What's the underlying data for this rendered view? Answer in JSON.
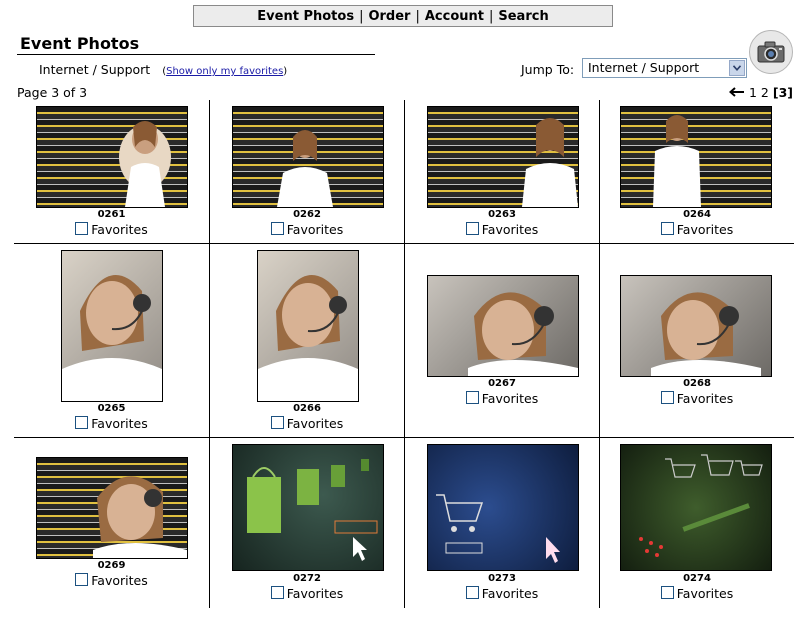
{
  "nav": {
    "items": [
      {
        "label": "Event Photos"
      },
      {
        "label": "Order"
      },
      {
        "label": "Account"
      },
      {
        "label": "Search"
      }
    ],
    "separator": "|"
  },
  "title": "Event Photos",
  "crumb": {
    "category": "Internet / Support",
    "fav_open": "(",
    "fav_link": "Show only my favorites",
    "fav_close": ")"
  },
  "jump": {
    "label": "Jump To:",
    "selected": "Internet / Support"
  },
  "page_info": "Page 3 of 3",
  "pager": {
    "pages": [
      "1",
      "2"
    ],
    "current": "[3]"
  },
  "favorites_label": "Favorites",
  "photos": [
    {
      "number": "0261"
    },
    {
      "number": "0262"
    },
    {
      "number": "0263"
    },
    {
      "number": "0264"
    },
    {
      "number": "0265"
    },
    {
      "number": "0266"
    },
    {
      "number": "0267"
    },
    {
      "number": "0268"
    },
    {
      "number": "0269"
    },
    {
      "number": "0272"
    },
    {
      "number": "0273"
    },
    {
      "number": "0274"
    }
  ],
  "colors": {
    "link": "#1a1aa6",
    "nav_bg": "#ececec"
  }
}
